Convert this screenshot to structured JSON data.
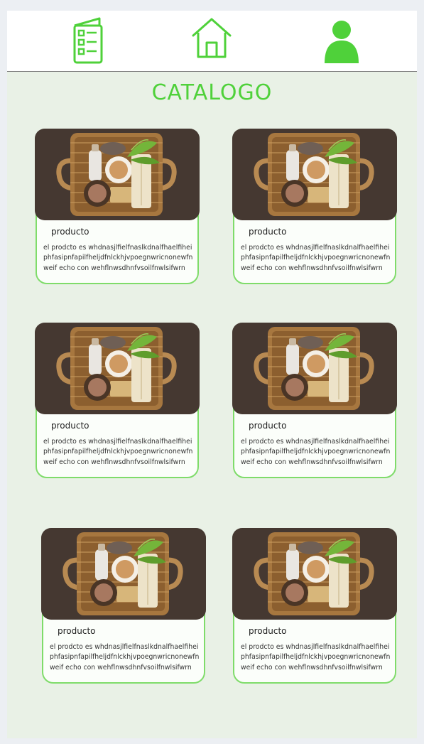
{
  "header": {
    "nav_icons": [
      "catalog-list-icon",
      "home-icon",
      "user-profile-icon"
    ],
    "accent_color": "#4fd13a"
  },
  "page": {
    "title": "CATALOGO"
  },
  "products": [
    {
      "name": "producto",
      "description": "el prodcto es whdnasjlfielfnaslkdnalfhaelfiheiphfasipnfapilfheljdfnlckhjvpoegnwricnonewfnweif echo con wehflnwsdhnfvsoilfnwlsifwrn"
    },
    {
      "name": "producto",
      "description": "el prodcto es whdnasjlfielfnaslkdnalfhaelfiheiphfasipnfapilfheljdfnlckhjvpoegnwricnonewfnweif echo con wehflnwsdhnfvsoilfnwlsifwrn"
    },
    {
      "name": "producto",
      "description": "el prodcto es whdnasjlfielfnaslkdnalfhaelfiheiphfasipnfapilfheljdfnlckhjvpoegnwricnonewfnweif echo con wehflnwsdhnfvsoilfnwlsifwrn"
    },
    {
      "name": "producto",
      "description": "el prodcto es whdnasjlfielfnaslkdnalfhaelfiheiphfasipnfapilfheljdfnlckhjvpoegnwricnonewfnweif echo con wehflnwsdhnfvsoilfnwlsifwrn"
    },
    {
      "name": "producto",
      "description": "el prodcto es whdnasjlfielfnaslkdnalfhaelfiheiphfasipnfapilfheljdfnlckhjvpoegnwricnonewfnweif echo con wehflnwsdhnfvsoilfnwlsifwrn"
    },
    {
      "name": "producto",
      "description": "el prodcto es whdnasjlfielfnaslkdnalfhaelfiheiphfasipnfapilfheljdfnlckhjvpoegnwricnonewfnweif echo con wehflnwsdhnfvsoilfnwlsifwrn"
    }
  ]
}
